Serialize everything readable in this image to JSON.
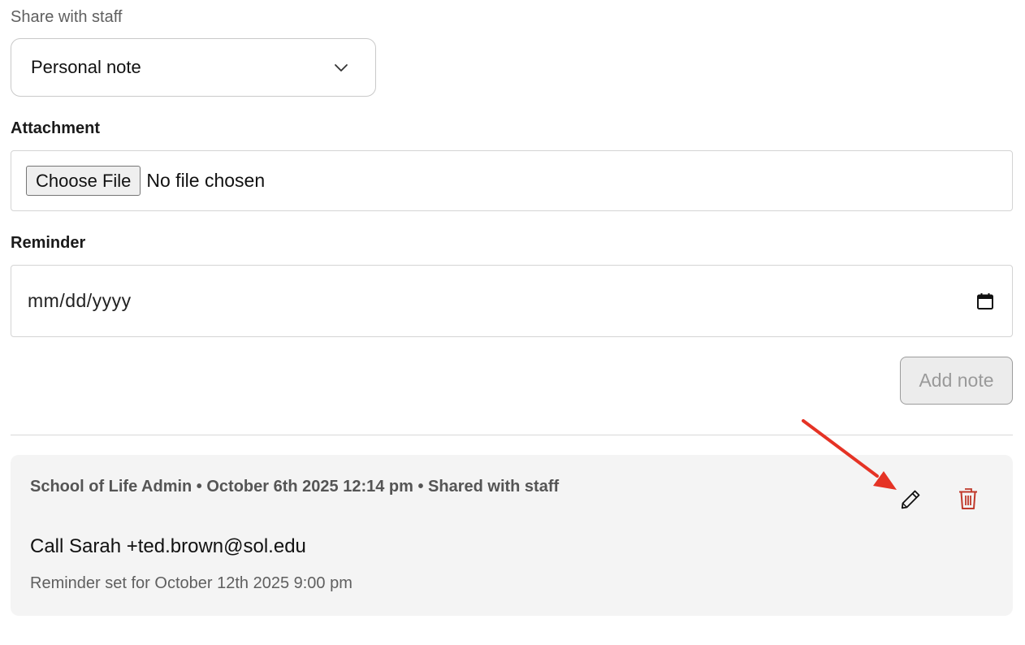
{
  "share": {
    "label": "Share with staff",
    "selected": "Personal note"
  },
  "attachment": {
    "label": "Attachment",
    "button_label": "Choose File",
    "status": "No file chosen"
  },
  "reminder": {
    "label": "Reminder",
    "placeholder": "mm/dd/yyyy"
  },
  "actions": {
    "add_note_label": "Add note"
  },
  "note": {
    "meta": "School of Life Admin • October 6th 2025 12:14 pm • Shared with staff",
    "body": "Call Sarah +ted.brown@sol.edu",
    "reminder_text": "Reminder set for October 12th 2025 9:00 pm",
    "edit_icon": "pencil-icon",
    "delete_icon": "trash-icon"
  },
  "colors": {
    "delete": "#c0392b",
    "annotation_arrow": "#e53325",
    "card_bg": "#f4f4f4"
  }
}
